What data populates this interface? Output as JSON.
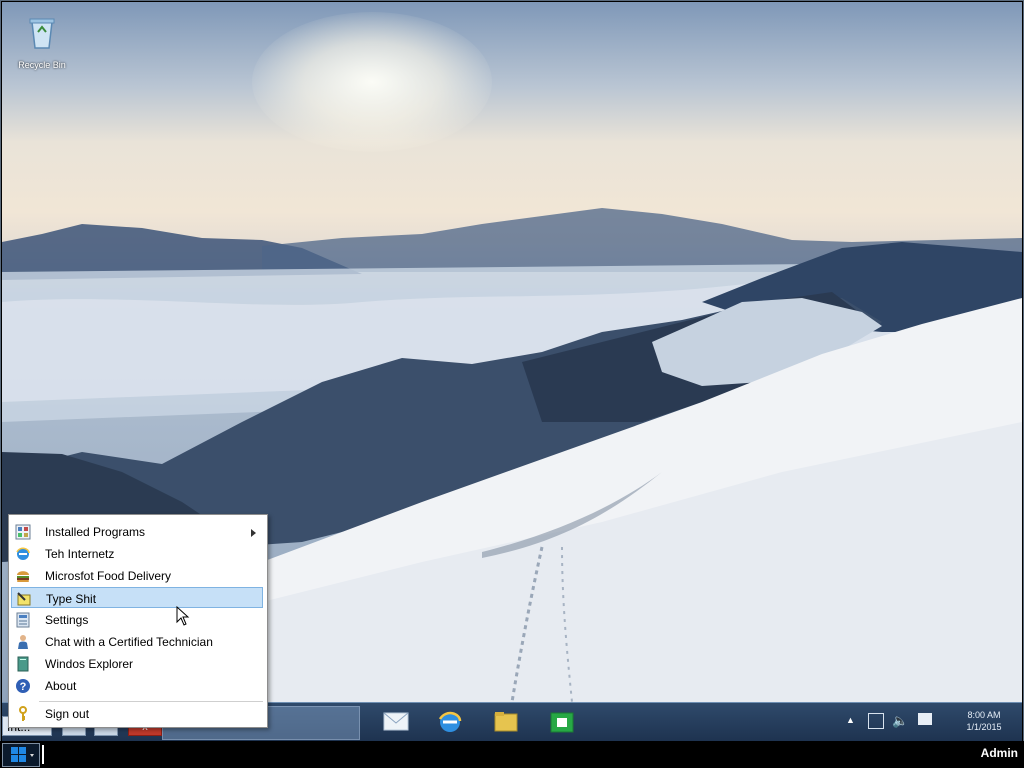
{
  "desktop": {
    "icon_name": "recycle-bin-icon",
    "icon_label": "Recycle Bin"
  },
  "start_menu": {
    "items": [
      {
        "label": "Installed Programs",
        "icon": "programs-grid-icon",
        "has_submenu": true
      },
      {
        "label": "Teh Internetz",
        "icon": "internet-explorer-icon"
      },
      {
        "label": "Microsfot Food Delivery",
        "icon": "burger-icon"
      },
      {
        "label": "Type Shit",
        "icon": "notepad-pencil-icon",
        "selected": true
      },
      {
        "label": "Settings",
        "icon": "settings-panel-icon"
      },
      {
        "label": "Chat with a Certified Technician",
        "icon": "technician-person-icon"
      },
      {
        "label": "Windos Explorer",
        "icon": "explorer-book-icon"
      },
      {
        "label": "About",
        "icon": "help-question-icon"
      },
      {
        "label": "Sign out",
        "icon": "key-icon"
      }
    ]
  },
  "taskbar": {
    "minimized_window_label": "Int...",
    "close_label": "x",
    "pinned_apps": [
      "mail-icon",
      "edge-icon",
      "file-explorer-icon",
      "store-icon"
    ],
    "clock_time": "8:00 AM",
    "clock_date": "1/1/2015"
  },
  "outer_bar": {
    "user_label": "Admin"
  },
  "colors": {
    "menu_highlight": "#c6e0f7",
    "taskbar": "#1e3350",
    "accent": "#1f88e5"
  }
}
